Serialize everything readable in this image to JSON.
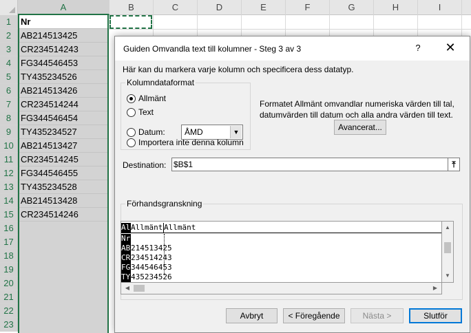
{
  "spreadsheet": {
    "columns": [
      "A",
      "B",
      "C",
      "D",
      "E",
      "F",
      "G",
      "H",
      "I"
    ],
    "rows": [
      "1",
      "2",
      "3",
      "4",
      "5",
      "6",
      "7",
      "8",
      "9",
      "10",
      "11",
      "12",
      "13",
      "14",
      "15",
      "16",
      "17",
      "18",
      "19",
      "20",
      "21",
      "22",
      "23"
    ],
    "cells_a": [
      "Nr",
      "AB214513425",
      "CR234514243",
      "FG344546453",
      "TY435234526",
      "AB214513426",
      "CR234514244",
      "FG344546454",
      "TY435234527",
      "AB214513427",
      "CR234514245",
      "FG344546455",
      "TY435234528",
      "AB214513428",
      "CR234514246"
    ]
  },
  "dialog": {
    "title": "Guiden Omvandla text till kolumner - Steg 3 av 3",
    "help": "?",
    "close": "✕",
    "intro": "Här kan du markera varje kolumn och specificera dess datatyp.",
    "format_group": {
      "title": "Kolumndataformat",
      "options": [
        "Allmänt",
        "Text",
        "Datum:",
        "Importera inte denna kolumn"
      ],
      "selected": "Allmänt",
      "date_value": "ÅMD"
    },
    "description": "Formatet Allmänt omvandlar numeriska värden till tal, datumvärden till datum och alla andra värden till text.",
    "advanced_label": "Avancerat...",
    "destination_label": "Destination:",
    "destination_value": "$B$1",
    "preview": {
      "title": "Förhandsgranskning",
      "headers": [
        "Allmänt",
        "Allmänt",
        "Allmänt"
      ],
      "first_col": [
        "Nr",
        "AB",
        "CR",
        "FG",
        "TY"
      ],
      "rest": [
        "",
        "214513425",
        "234514243",
        "344546453",
        "435234526"
      ]
    },
    "buttons": {
      "cancel": "Avbryt",
      "back": "< Föregående",
      "next": "Nästa >",
      "finish": "Slutför"
    }
  }
}
